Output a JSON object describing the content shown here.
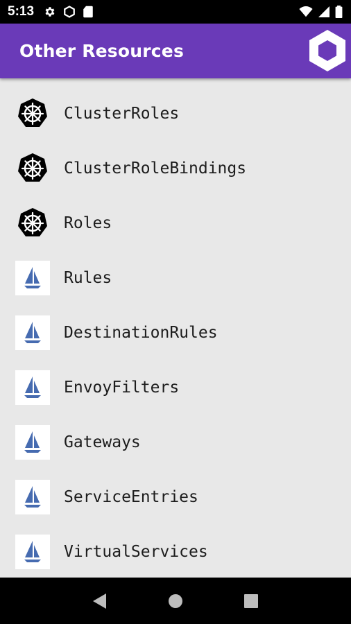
{
  "status_bar": {
    "time": "5:13",
    "left_icons": [
      "gear-icon",
      "hexagon-icon",
      "sd-card-icon"
    ],
    "right_icons": [
      "wifi-icon",
      "signal-icon",
      "battery-icon"
    ]
  },
  "app_bar": {
    "title": "Other Resources",
    "logo": "hexagon-logo-icon"
  },
  "resources": [
    {
      "label": "ClusterRoles",
      "icon": "kubernetes-helm-icon"
    },
    {
      "label": "ClusterRoleBindings",
      "icon": "kubernetes-helm-icon"
    },
    {
      "label": "Roles",
      "icon": "kubernetes-helm-icon"
    },
    {
      "label": "Rules",
      "icon": "istio-sail-icon"
    },
    {
      "label": "DestinationRules",
      "icon": "istio-sail-icon"
    },
    {
      "label": "EnvoyFilters",
      "icon": "istio-sail-icon"
    },
    {
      "label": "Gateways",
      "icon": "istio-sail-icon"
    },
    {
      "label": "ServiceEntries",
      "icon": "istio-sail-icon"
    },
    {
      "label": "VirtualServices",
      "icon": "istio-sail-icon"
    }
  ],
  "nav_bar": {
    "buttons": [
      "back-icon",
      "home-icon",
      "recents-icon"
    ]
  },
  "colors": {
    "app_bar": "#6a3ab8",
    "background": "#e8e8e8",
    "istio_blue": "#466bb0"
  }
}
